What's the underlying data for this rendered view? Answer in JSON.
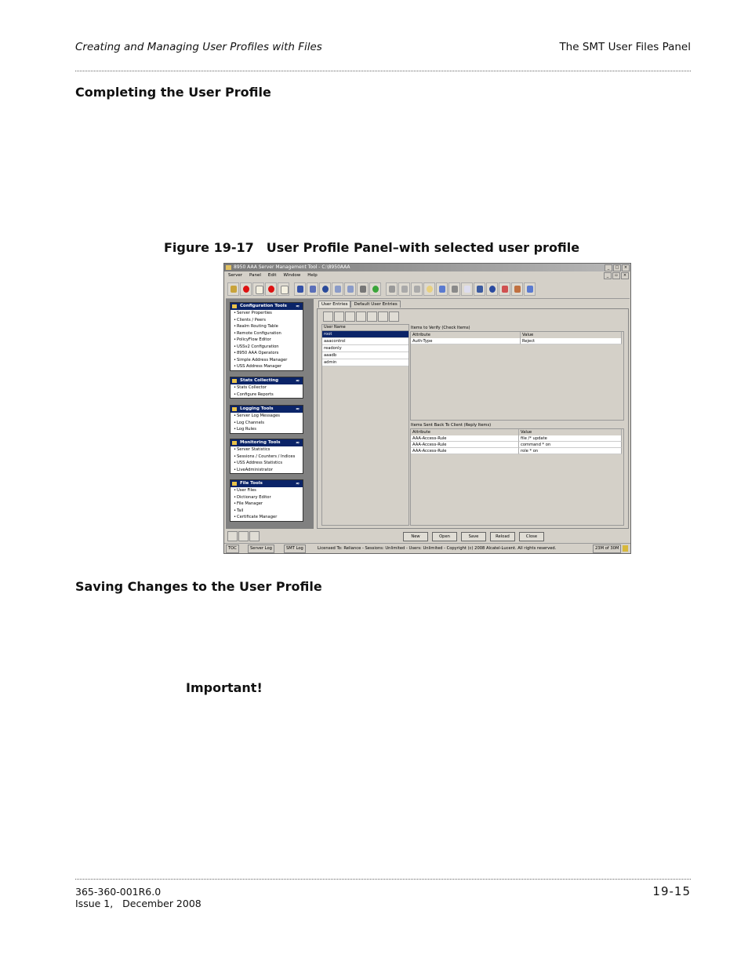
{
  "header": {
    "left": "Creating and Managing User Profiles with Files",
    "right": "The SMT User Files Panel"
  },
  "section1": {
    "title": "Completing the User Profile"
  },
  "figure": {
    "number": "Figure 19-17",
    "title": "User Profile Panel–with selected user profile"
  },
  "section2": {
    "title": "Saving Changes to the User Profile"
  },
  "important": "Important!",
  "footer": {
    "doc_id": "365-360-001R6.0",
    "issue": "Issue 1,   December 2008",
    "page": "19-15"
  },
  "screenshot": {
    "window_title": "8950 AAA Server Management Tool - C:\\8950AAA",
    "menu": [
      "Server",
      "Panel",
      "Edit",
      "Window",
      "Help"
    ],
    "groups": [
      {
        "title": "Configuration Tools",
        "items": [
          "Server Properties",
          "Clients / Peers",
          "Realm Routing Table",
          "Remote Configuration",
          "PolicyFlow Editor",
          "USSv2 Configuration",
          "8950 AAA Operators",
          "Simple Address Manager",
          "USS Address Manager"
        ]
      },
      {
        "title": "Stats Collecting",
        "items": [
          "Stats Collector",
          "Configure Reports"
        ]
      },
      {
        "title": "Logging Tools",
        "items": [
          "Server Log Messages",
          "Log Channels",
          "Log Rules"
        ]
      },
      {
        "title": "Monitoring Tools",
        "items": [
          "Server Statistics",
          "Sessions / Counters / Indices",
          "USS Address Statistics",
          "LiveAdministrator"
        ]
      },
      {
        "title": "File Tools",
        "items": [
          "User Files",
          "Dictionary Editor",
          "File Manager",
          "Tail",
          "Certificate Manager"
        ]
      }
    ],
    "tabs": [
      "User Entries",
      "Default User Entries"
    ],
    "user_list_header": "User Name",
    "users": [
      "root",
      "aaacontrol",
      "readonly",
      "aaadb",
      "admin"
    ],
    "check_items": {
      "label": "Items to Verify (Check Items)",
      "columns": [
        "Attribute",
        "Value"
      ],
      "rows": [
        [
          "Auth-Type",
          "Reject"
        ]
      ]
    },
    "reply_items": {
      "label": "Items Sent Back To Client (Reply Items)",
      "columns": [
        "Attribute",
        "Value"
      ],
      "rows": [
        [
          "AAA-Access-Rule",
          "file /* update"
        ],
        [
          "AAA-Access-Rule",
          "command * on"
        ],
        [
          "AAA-Access-Rule",
          "role * on"
        ]
      ]
    },
    "buttons": [
      "New",
      "Open",
      "Save",
      "Reload",
      "Close"
    ],
    "status_tabs": [
      "TOC",
      "Server Log",
      "SMT Log"
    ],
    "license": "Licensed To: Reliance - Sessions: Unlimited - Users: Unlimited - Copyright (c) 2008 Alcatel-Lucent. All rights reserved.",
    "memory": "23M of 30M"
  }
}
